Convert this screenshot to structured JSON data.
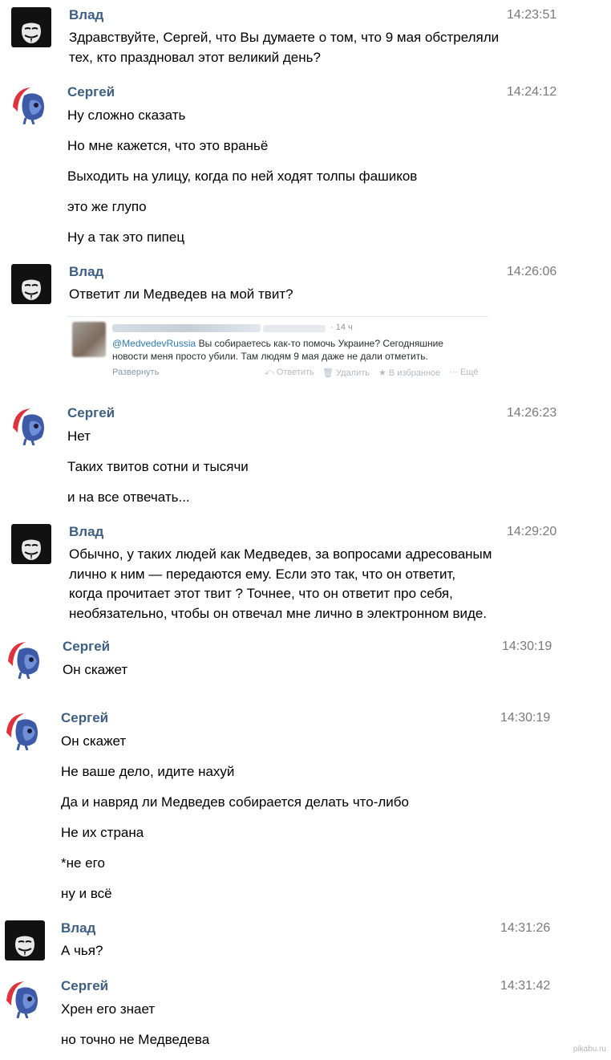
{
  "users": {
    "vlad": {
      "name": "Влад",
      "avatar_icon": "guy-fawkes-mask-icon"
    },
    "sergey": {
      "name": "Сергей",
      "avatar_icon": "pony-icon"
    }
  },
  "messages": [
    {
      "time": "14:23:51",
      "lines": [
        "Здравствуйте, Сергей, что Вы думаете о том, что 9 мая обстреляли",
        "тех, кто праздновал этот великий день?"
      ]
    },
    {
      "time": "14:24:12",
      "lines": [
        "Ну сложно сказать",
        "Но мне кажется, что это враньё",
        "Выходить на улицу, когда по ней ходят толпы фашиков",
        "это же глупо",
        "Ну а так это пипец"
      ]
    },
    {
      "time": "14:26:06",
      "lines": [
        "Ответит ли Медведев на мой твит?"
      ]
    },
    {
      "time": "14:26:23",
      "lines": [
        "Нет",
        "Таких твитов сотни и тысячи",
        "и на все отвечать..."
      ]
    },
    {
      "time": "14:29:20",
      "lines": [
        "Обычно, у таких людей как Медведев, за вопросами адресованым",
        "лично к ним — передаются ему. Если это так, что он ответит,",
        "когда прочитает этот  твит ? Точнее, что он ответит про себя,",
        "необязательно, чтобы он отвечал мне лично в электронном виде."
      ]
    },
    {
      "time": "14:30:19",
      "lines": [
        "Он скажет"
      ]
    },
    {
      "time": "14:30:19",
      "lines": [
        "Он скажет",
        "Не ваше дело, идите нахуй",
        "Да и навряд ли Медведев собирается делать что-либо",
        "Не их страна",
        "*не его",
        "ну и всё"
      ]
    },
    {
      "time": "14:31:26",
      "lines": [
        "А чья?"
      ]
    },
    {
      "time": "14:31:42",
      "lines": [
        "Хрен его знает",
        "но точно не Медведева"
      ]
    }
  ],
  "tweet": {
    "time": "· 14 ч",
    "mention": "@MedvedevRussia",
    "text_1": " Вы собираетесь как-то помочь Украине? Сегодняшние",
    "text_2": "новости меня просто убили. Там людям 9 мая даже не дали отметить.",
    "expand": "Развернуть",
    "reply": "⤺ Ответить",
    "delete": "🗑 Удалить",
    "favorite": "★ В избранное",
    "more": "··· Ещё"
  },
  "watermark": "pikabu.ru"
}
